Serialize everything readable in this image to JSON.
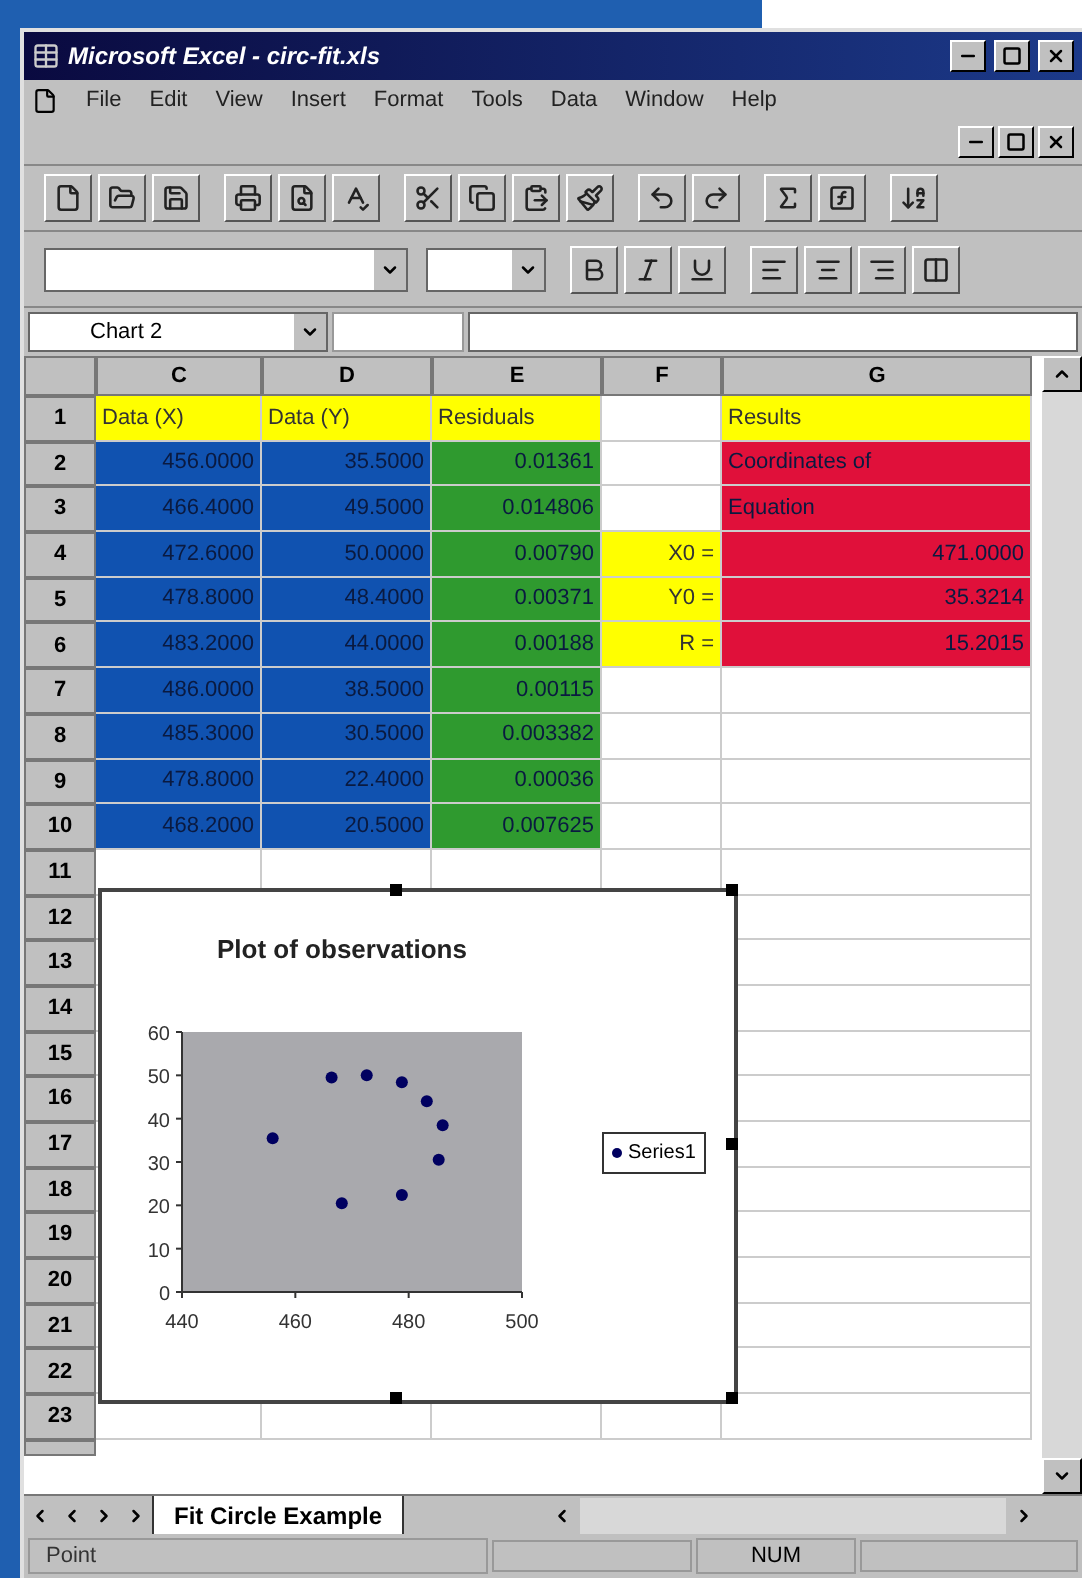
{
  "window": {
    "title": "Microsoft Excel - circ-fit.xls"
  },
  "menu": [
    "File",
    "Edit",
    "View",
    "Insert",
    "Format",
    "Tools",
    "Data",
    "Window",
    "Help"
  ],
  "name_box": {
    "value": "Chart 2"
  },
  "sheet": {
    "columns": [
      "C",
      "D",
      "E",
      "F",
      "G"
    ],
    "rows": [
      {
        "number": "1",
        "cells": [
          {
            "text": "Data (X)",
            "color": "#ffff00"
          },
          {
            "text": "Data (Y)",
            "color": "#ffff00"
          },
          {
            "text": "Residuals",
            "color": "#ffff00"
          },
          {
            "color": "#ffffff"
          },
          {
            "text": "Results",
            "color": "#ffff00"
          }
        ]
      },
      {
        "number": "2",
        "cells": [
          {
            "text": "456.0000",
            "color": "#1052b0"
          },
          {
            "text": "35.5000",
            "color": "#1052b0"
          },
          {
            "text": "0.01361",
            "color": "#2f9a2f"
          },
          {
            "color": "#ffffff"
          },
          {
            "text": "Coordinates of",
            "color": "#e0103a",
            "kind": "label"
          }
        ]
      },
      {
        "number": "3",
        "cells": [
          {
            "text": "466.4000",
            "color": "#1052b0"
          },
          {
            "text": "49.5000",
            "color": "#1052b0"
          },
          {
            "text": "0.014806",
            "color": "#2f9a2f"
          },
          {
            "color": "#ffffff"
          },
          {
            "text": "Equation",
            "color": "#e0103a",
            "kind": "label"
          }
        ]
      },
      {
        "number": "4",
        "cells": [
          {
            "text": "472.6000",
            "color": "#1052b0"
          },
          {
            "text": "50.0000",
            "color": "#1052b0"
          },
          {
            "text": "0.00790",
            "color": "#2f9a2f"
          },
          {
            "text": "X0 =",
            "color": "#ffff00"
          },
          {
            "text": "471.0000",
            "color": "#e0103a"
          }
        ]
      },
      {
        "number": "5",
        "cells": [
          {
            "text": "478.8000",
            "color": "#1052b0"
          },
          {
            "text": "48.4000",
            "color": "#1052b0"
          },
          {
            "text": "0.00371",
            "color": "#2f9a2f"
          },
          {
            "text": "Y0 =",
            "color": "#ffff00"
          },
          {
            "text": "35.3214",
            "color": "#e0103a"
          }
        ]
      },
      {
        "number": "6",
        "cells": [
          {
            "text": "483.2000",
            "color": "#1052b0"
          },
          {
            "text": "44.0000",
            "color": "#1052b0"
          },
          {
            "text": "0.00188",
            "color": "#2f9a2f"
          },
          {
            "text": "R =",
            "color": "#ffff00"
          },
          {
            "text": "15.2015",
            "color": "#e0103a"
          }
        ]
      },
      {
        "number": "7",
        "cells": [
          {
            "text": "486.0000",
            "color": "#1052b0"
          },
          {
            "text": "38.5000",
            "color": "#1052b0"
          },
          {
            "text": "0.00115",
            "color": "#2f9a2f"
          },
          {
            "color": "#ffffff"
          },
          {
            "color": "#ffffff"
          }
        ]
      },
      {
        "number": "8",
        "cells": [
          {
            "text": "485.3000",
            "color": "#1052b0"
          },
          {
            "text": "30.5000",
            "color": "#1052b0"
          },
          {
            "text": "0.003382",
            "color": "#2f9a2f"
          },
          {
            "color": "#ffffff"
          },
          {
            "color": "#ffffff"
          }
        ]
      },
      {
        "number": "9",
        "cells": [
          {
            "text": "478.8000",
            "color": "#1052b0"
          },
          {
            "text": "22.4000",
            "color": "#1052b0"
          },
          {
            "text": "0.00036",
            "color": "#2f9a2f"
          },
          {
            "color": "#ffffff"
          },
          {
            "color": "#ffffff"
          }
        ]
      },
      {
        "number": "10",
        "cells": [
          {
            "text": "468.2000",
            "color": "#1052b0"
          },
          {
            "text": "20.5000",
            "color": "#1052b0"
          },
          {
            "text": "0.007625",
            "color": "#2f9a2f"
          },
          {
            "color": "#ffffff"
          },
          {
            "color": "#ffffff"
          }
        ]
      },
      {
        "number": "11",
        "cells": [
          {
            "color": "#ffffff"
          },
          {
            "color": "#ffffff"
          },
          {
            "color": "#ffffff"
          },
          {
            "color": "#ffffff"
          },
          {
            "color": "#ffffff"
          }
        ]
      }
    ],
    "more_row_numbers": [
      "12",
      "13",
      "14",
      "15",
      "16",
      "17",
      "18",
      "19",
      "20",
      "21",
      "22",
      "23"
    ]
  },
  "chart": {
    "chart_data": {
      "type": "scatter",
      "title": "Plot of observations",
      "x": [
        456,
        466.4,
        472.6,
        478.8,
        483.2,
        486,
        485.3,
        478.8,
        468.2
      ],
      "series": [
        {
          "name": "Series1",
          "color": "#000060",
          "values": [
            35.5,
            49.5,
            50,
            48.4,
            44,
            38.5,
            30.5,
            22.4,
            20.5
          ]
        }
      ],
      "xlim": [
        440,
        500
      ],
      "ylim": [
        0,
        60
      ],
      "xticks": [
        440,
        460,
        480,
        500
      ],
      "yticks": [
        0,
        10,
        20,
        30,
        40,
        50,
        60
      ]
    }
  },
  "sheet_tabs": [
    {
      "label": "Fit Circle Example",
      "selected": true
    }
  ],
  "status_bar": {
    "mode": "Point",
    "indicator": "NUM"
  }
}
